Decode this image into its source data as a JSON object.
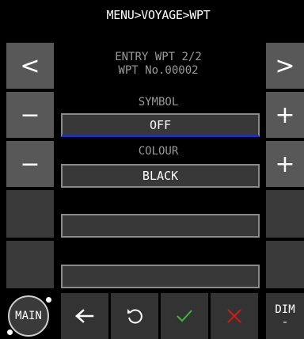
{
  "header": {
    "title": "MENU>VOYAGE>WPT"
  },
  "entry": {
    "line1": "ENTRY WPT 2/2",
    "line2": "WPT No.00002"
  },
  "nav": {
    "prev_label": "<",
    "next_label": ">"
  },
  "symbol": {
    "label": "SYMBOL",
    "value": "OFF",
    "dec_label": "−",
    "inc_label": "+"
  },
  "colour": {
    "label": "COLOUR",
    "value": "BLACK",
    "dec_label": "−",
    "inc_label": "+"
  },
  "fields": {
    "field3": "",
    "field4": ""
  },
  "footer": {
    "main_label": "MAIN",
    "dim_label": "DIM",
    "dim_sub": "-"
  },
  "colors": {
    "accent_blue": "#1a2bd8",
    "ok_green": "#3db83d",
    "cancel_red": "#d01818",
    "side_button": "#585858"
  },
  "icons": [
    "back-arrow-icon",
    "undo-icon",
    "check-icon",
    "close-icon"
  ]
}
